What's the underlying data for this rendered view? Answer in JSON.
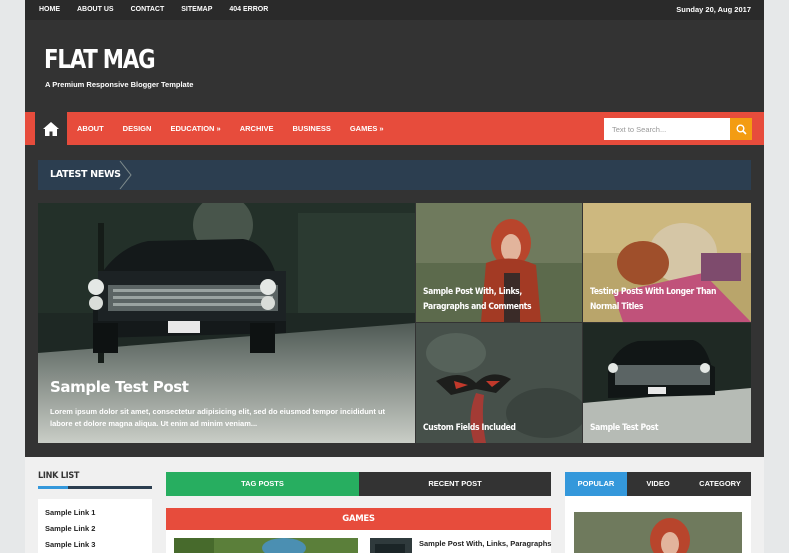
{
  "topbar": {
    "links": [
      "HOME",
      "ABOUT US",
      "CONTACT",
      "SITEMAP",
      "404 ERROR"
    ],
    "date": "Sunday 20, Aug 2017"
  },
  "header": {
    "logo": "FLAT MAG",
    "tagline": "A Premium Responsive Blogger Template"
  },
  "nav": {
    "items": [
      "ABOUT",
      "DESIGN",
      "EDUCATION »",
      "ARCHIVE",
      "BUSINESS",
      "GAMES »"
    ],
    "search_placeholder": "Text to Search..."
  },
  "latest": {
    "label": "LATEST NEWS"
  },
  "featured": {
    "big": {
      "title": "Sample Test Post",
      "desc": "Lorem ipsum dolor sit amet, consectetur adipisicing elit, sed do eiusmod tempor incididunt ut labore et dolore magna aliqua. Ut enim ad minim veniam..."
    },
    "items": [
      "Sample Post With, Links, Paragraphs and Comments",
      "Testing Posts With Longer Than Normal Titles",
      "Custom Fields Included",
      "Sample Test Post"
    ]
  },
  "linklist": {
    "title": "LINK LIST",
    "links": [
      "Sample Link 1",
      "Sample Link 2",
      "Sample Link 3"
    ]
  },
  "tabs": {
    "tag_posts": "TAG POSTS",
    "recent_post": "RECENT POST"
  },
  "games": {
    "title": "GAMES",
    "post_title": "Sample Post With, Links, Paragraphs"
  },
  "right_tabs": [
    "POPULAR",
    "VIDEO",
    "CATEGORY"
  ],
  "colors": {
    "red": "#e74c3c",
    "dark": "#333333",
    "navy": "#2c3e50",
    "green": "#27ae60",
    "blue": "#3498db",
    "orange": "#f39c12"
  }
}
